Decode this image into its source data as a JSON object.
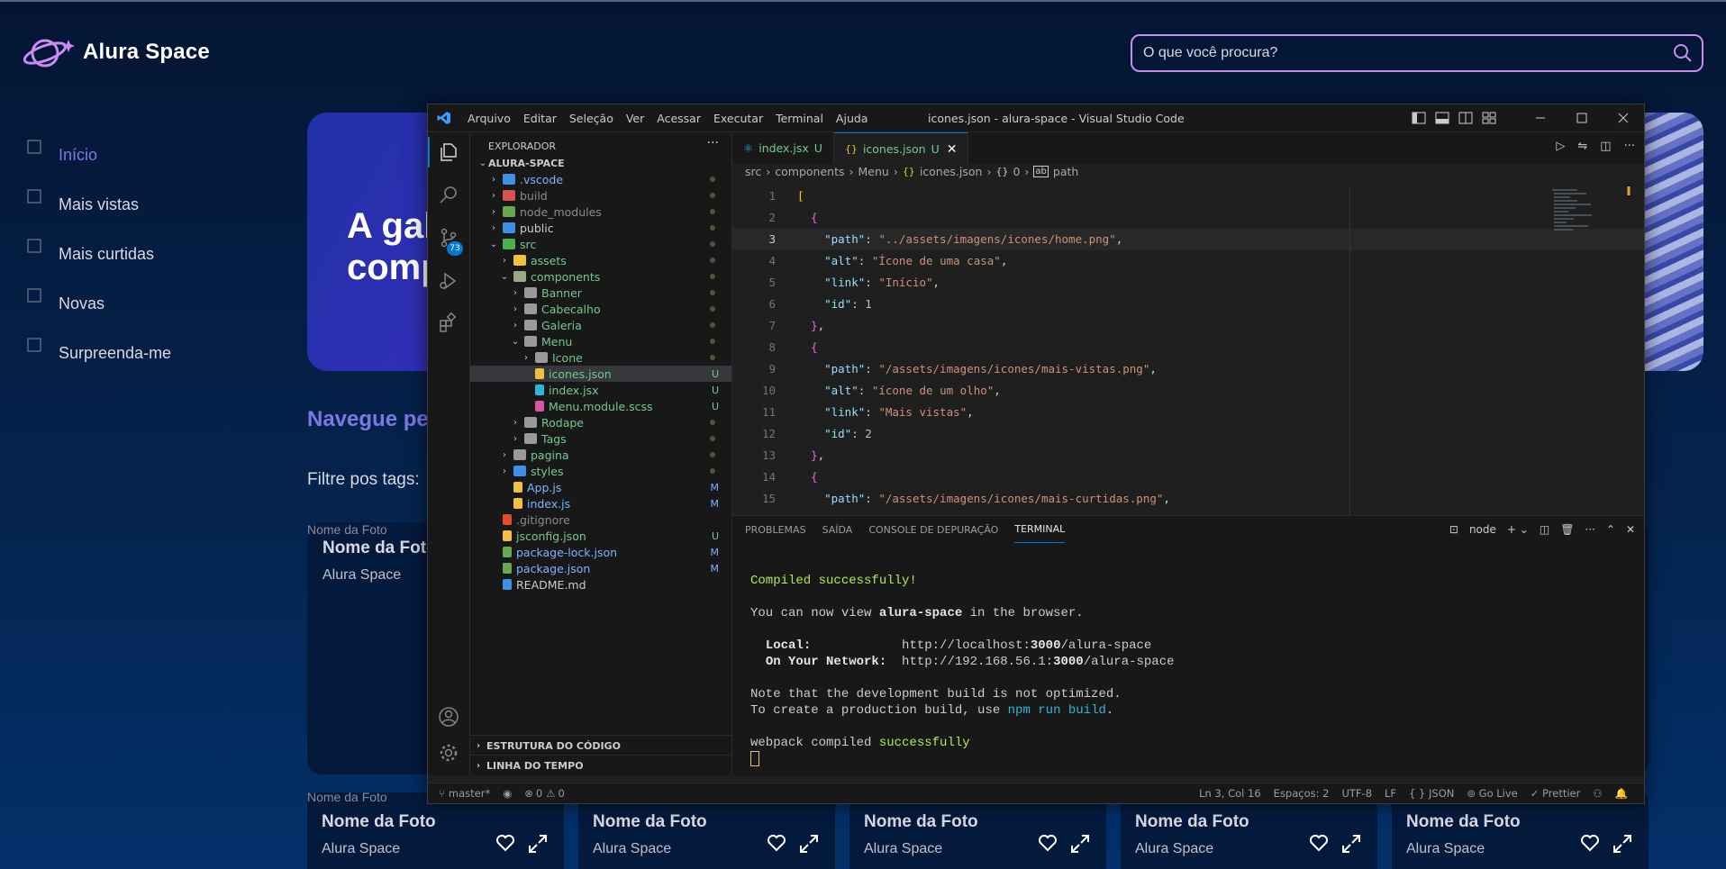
{
  "site": {
    "logo_text": "Alura Space",
    "search_placeholder": "O que você procura?",
    "nav": [
      {
        "label": "Início",
        "active": true
      },
      {
        "label": "Mais vistas"
      },
      {
        "label": "Mais curtidas"
      },
      {
        "label": "Novas"
      },
      {
        "label": "Surpreenda-me"
      }
    ],
    "banner_title": "A gal\ncomp",
    "navegue_heading": "Navegue pela",
    "filter_label": "Filtre pos tags:",
    "featured": {
      "alt": "Nome da Foto",
      "title": "Nome da Foto",
      "subtitle": "Alura Space"
    },
    "cards": [
      {
        "alt": "Nome da Foto",
        "title": "Nome da Foto",
        "subtitle": "Alura Space"
      },
      {
        "title": "Nome da Foto",
        "subtitle": "Alura Space"
      },
      {
        "title": "Nome da Foto",
        "subtitle": "Alura Space"
      },
      {
        "title": "Nome da Foto",
        "subtitle": "Alura Space"
      },
      {
        "title": "Nome da Foto",
        "subtitle": "Alura Space"
      }
    ],
    "colors": {
      "accent": "#7b78e5",
      "search_border": "#c98cf1"
    }
  },
  "vscode": {
    "menu": [
      "Arquivo",
      "Editar",
      "Seleção",
      "Ver",
      "Acessar",
      "Executar",
      "Terminal",
      "Ajuda"
    ],
    "window_title": "icones.json - alura-space - Visual Studio Code",
    "scm_badge": "73",
    "explorer_title": "EXPLORADOR",
    "tree": [
      {
        "label": "ALURA-SPACE",
        "depth": 0,
        "type": "root"
      },
      {
        "label": ".vscode",
        "depth": 1,
        "type": "folder",
        "color": "#7fb2ff",
        "icolor": "#3f8ee8"
      },
      {
        "label": "build",
        "depth": 1,
        "type": "folder",
        "color": "#8c8c8c",
        "icolor": "#d9534f"
      },
      {
        "label": "node_modules",
        "depth": 1,
        "type": "folder",
        "color": "#8c8c8c",
        "icolor": "#6aa84f"
      },
      {
        "label": "public",
        "depth": 1,
        "type": "folder",
        "color": "#cccccc",
        "icolor": "#3f8ee8"
      },
      {
        "label": "src",
        "depth": 1,
        "type": "folder-open",
        "color": "#73c991",
        "icolor": "#4caf50"
      },
      {
        "label": "assets",
        "depth": 2,
        "type": "folder",
        "color": "#73c991",
        "icolor": "#f0c040"
      },
      {
        "label": "components",
        "depth": 2,
        "type": "folder-open",
        "color": "#73c991",
        "icolor": "#9aa88a"
      },
      {
        "label": "Banner",
        "depth": 3,
        "type": "folder",
        "color": "#73c991",
        "icolor": "#9a9a9a"
      },
      {
        "label": "Cabecalho",
        "depth": 3,
        "type": "folder",
        "color": "#73c991",
        "icolor": "#9a9a9a"
      },
      {
        "label": "Galeria",
        "depth": 3,
        "type": "folder",
        "color": "#73c991",
        "icolor": "#9a9a9a"
      },
      {
        "label": "Menu",
        "depth": 3,
        "type": "folder-open",
        "color": "#73c991",
        "icolor": "#9a9a9a"
      },
      {
        "label": "Icone",
        "depth": 4,
        "type": "folder",
        "color": "#73c991",
        "icolor": "#9a9a9a"
      },
      {
        "label": "icones.json",
        "depth": 4,
        "type": "file",
        "color": "#73c991",
        "icolor": "#f0c040",
        "status": "U",
        "selected": true
      },
      {
        "label": "index.jsx",
        "depth": 4,
        "type": "file",
        "color": "#73c991",
        "icolor": "#29b8db",
        "status": "U"
      },
      {
        "label": "Menu.module.scss",
        "depth": 4,
        "type": "file",
        "color": "#73c991",
        "icolor": "#d6579b",
        "status": "U"
      },
      {
        "label": "Rodape",
        "depth": 3,
        "type": "folder",
        "color": "#73c991",
        "icolor": "#9a9a9a"
      },
      {
        "label": "Tags",
        "depth": 3,
        "type": "folder",
        "color": "#73c991",
        "icolor": "#9a9a9a"
      },
      {
        "label": "pagina",
        "depth": 2,
        "type": "folder",
        "color": "#73c991",
        "icolor": "#9a9a9a"
      },
      {
        "label": "styles",
        "depth": 2,
        "type": "folder",
        "color": "#73c991",
        "icolor": "#3f8ee8"
      },
      {
        "label": "App.js",
        "depth": 2,
        "type": "file",
        "color": "#7fb2ff",
        "icolor": "#f0c040",
        "status": "M"
      },
      {
        "label": "index.js",
        "depth": 2,
        "type": "file",
        "color": "#7fb2ff",
        "icolor": "#f0c040",
        "status": "M"
      },
      {
        "label": ".gitignore",
        "depth": 1,
        "type": "file",
        "color": "#8c8c8c",
        "icolor": "#e44d26"
      },
      {
        "label": "jsconfig.json",
        "depth": 1,
        "type": "file",
        "color": "#73c991",
        "icolor": "#f0c040",
        "status": "U"
      },
      {
        "label": "package-lock.json",
        "depth": 1,
        "type": "file",
        "color": "#7fb2ff",
        "icolor": "#6aa84f",
        "status": "M"
      },
      {
        "label": "package.json",
        "depth": 1,
        "type": "file",
        "color": "#7fb2ff",
        "icolor": "#6aa84f",
        "status": "M"
      },
      {
        "label": "README.md",
        "depth": 1,
        "type": "file",
        "color": "#cccccc",
        "icolor": "#3f8ee8"
      }
    ],
    "sections": [
      "ESTRUTURA DO CÓDIGO",
      "LINHA DO TEMPO"
    ],
    "tabs": [
      {
        "label": "index.jsx",
        "status": "U",
        "active": false
      },
      {
        "label": "icones.json",
        "status": "U",
        "active": true
      }
    ],
    "breadcrumbs": [
      "src",
      "components",
      "Menu",
      "icones.json",
      "0",
      "path"
    ],
    "code": [
      {
        "n": "1",
        "html": "<span class='brk1'>[</span>"
      },
      {
        "n": "2",
        "html": "  <span class='brk2'>{</span>"
      },
      {
        "n": "3",
        "html": "    <span class='key'>\"path\"</span><span class='punc'>: </span><span class='str'>\"../assets/imagens/icones/home.png\"</span><span class='punc'>,</span>",
        "current": true
      },
      {
        "n": "4",
        "html": "    <span class='key'>\"alt\"</span><span class='punc'>: </span><span class='str'>\"Ícone de uma casa\"</span><span class='punc'>,</span>"
      },
      {
        "n": "5",
        "html": "    <span class='key'>\"link\"</span><span class='punc'>: </span><span class='str'>\"Início\"</span><span class='punc'>,</span>"
      },
      {
        "n": "6",
        "html": "    <span class='key'>\"id\"</span><span class='punc'>: </span><span class='num'>1</span>"
      },
      {
        "n": "7",
        "html": "  <span class='brk2'>}</span><span class='punc'>,</span>"
      },
      {
        "n": "8",
        "html": "  <span class='brk2'>{</span>"
      },
      {
        "n": "9",
        "html": "    <span class='key'>\"path\"</span><span class='punc'>: </span><span class='str'>\"/assets/imagens/icones/mais-vistas.png\"</span><span class='punc'>,</span>"
      },
      {
        "n": "10",
        "html": "    <span class='key'>\"alt\"</span><span class='punc'>: </span><span class='str'>\"ícone de um olho\"</span><span class='punc'>,</span>"
      },
      {
        "n": "11",
        "html": "    <span class='key'>\"link\"</span><span class='punc'>: </span><span class='str'>\"Mais vistas\"</span><span class='punc'>,</span>"
      },
      {
        "n": "12",
        "html": "    <span class='key'>\"id\"</span><span class='punc'>: </span><span class='num'>2</span>"
      },
      {
        "n": "13",
        "html": "  <span class='brk2'>}</span><span class='punc'>,</span>"
      },
      {
        "n": "14",
        "html": "  <span class='brk2'>{</span>"
      },
      {
        "n": "15",
        "html": "    <span class='key'>\"path\"</span><span class='punc'>: </span><span class='str'>\"/assets/imagens/icones/mais-curtidas.png\"</span><span class='punc'>,</span>"
      }
    ],
    "panel_tabs": [
      "PROBLEMAS",
      "SAÍDA",
      "CONSOLE DE DEPURAÇÃO",
      "TERMINAL"
    ],
    "terminal_shell": "node",
    "terminal": [
      {
        "html": ""
      },
      {
        "html": "<span class='green'>Compiled successfully!</span>"
      },
      {
        "html": ""
      },
      {
        "html": "You can now view <span class='bold'>alura-space</span> in the browser."
      },
      {
        "html": ""
      },
      {
        "html": "  <span class='bold'>Local:</span>            http://localhost:<span class='bold'>3000</span>/alura-space"
      },
      {
        "html": "  <span class='bold'>On Your Network:</span>  http://192.168.56.1:<span class='bold'>3000</span>/alura-space"
      },
      {
        "html": ""
      },
      {
        "html": "Note that the development build is not optimized."
      },
      {
        "html": "To create a production build, use <span class='cyan'>npm run build</span>."
      },
      {
        "html": ""
      },
      {
        "html": "webpack compiled <span class='green'>successfully</span>"
      }
    ],
    "status": {
      "branch": "master*",
      "errors": "0",
      "warnings": "0",
      "position": "Ln 3, Col 16",
      "spaces": "Espaços: 2",
      "encoding": "UTF-8",
      "eol": "LF",
      "language": "JSON",
      "golive": "Go Live",
      "prettier": "Prettier"
    }
  }
}
